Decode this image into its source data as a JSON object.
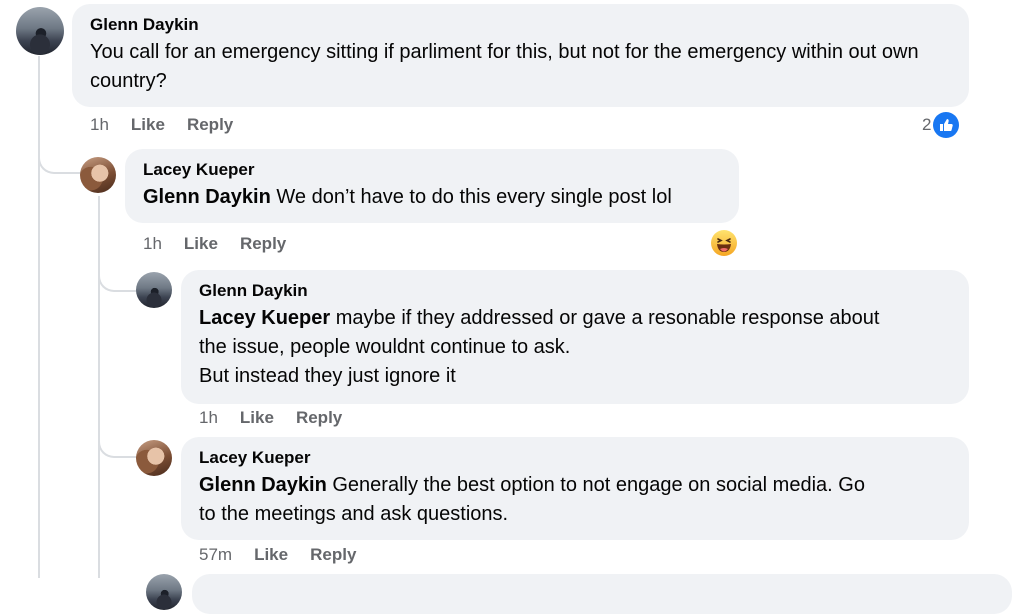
{
  "comments": [
    {
      "author": "Glenn Daykin",
      "text": "You call for an emergency sitting if parliment for this, but not for the emergency within out own country?",
      "time": "1h",
      "like_label": "Like",
      "reply_label": "Reply",
      "reaction_count": "2",
      "reaction_icon": "like-icon"
    },
    {
      "author": "Lacey Kueper",
      "mention": "Glenn Daykin",
      "text": "We don’t have to do this every single post lol",
      "time": "1h",
      "like_label": "Like",
      "reply_label": "Reply",
      "reaction_icon": "haha-icon"
    },
    {
      "author": "Glenn Daykin",
      "mention": "Lacey Kueper",
      "text_line1": "maybe if they addressed or gave a resonable response about",
      "text_line2": "the issue, people wouldnt continue to ask.",
      "text_line3": "But instead they just ignore it",
      "time": "1h",
      "like_label": "Like",
      "reply_label": "Reply"
    },
    {
      "author": "Lacey Kueper",
      "mention": "Glenn Daykin",
      "text_line1": "Generally the best option to not engage on social media. Go",
      "text_line2": "to the meetings and ask questions.",
      "time": "57m",
      "like_label": "Like",
      "reply_label": "Reply"
    }
  ],
  "colors": {
    "bubble": "#f0f2f5",
    "meta_text": "#65676b",
    "like_blue": "#1877f2",
    "thread_line": "#dadde1"
  }
}
